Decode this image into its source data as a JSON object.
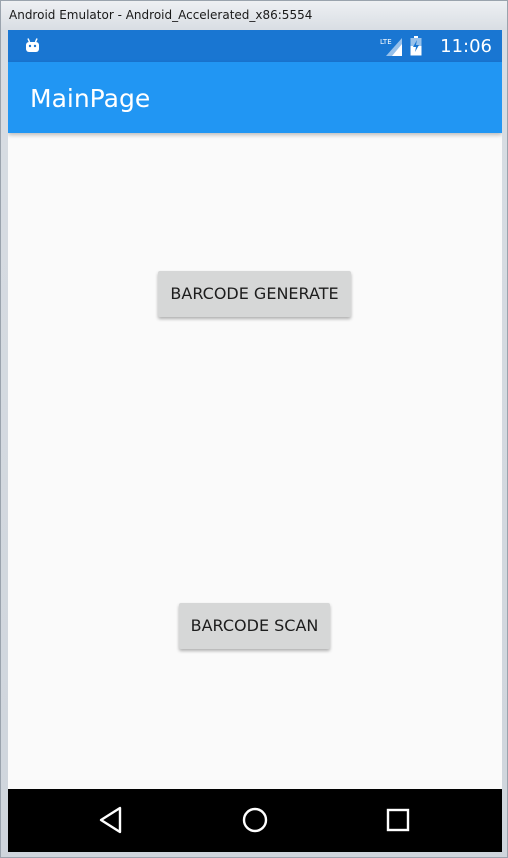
{
  "window": {
    "title": "Android Emulator - Android_Accelerated_x86:5554"
  },
  "status_bar": {
    "time": "11:06",
    "network": "LTE",
    "icons": [
      "android-notification-icon",
      "lte-signal-icon",
      "battery-charging-icon"
    ],
    "color": "#1976d2"
  },
  "app_bar": {
    "title": "MainPage",
    "color": "#2196f3"
  },
  "content": {
    "generate_button_label": "BARCODE GENERATE",
    "scan_button_label": "BARCODE SCAN",
    "background": "#fafafa"
  },
  "nav_bar": {
    "items": [
      "back-icon",
      "home-icon",
      "recents-icon"
    ]
  }
}
